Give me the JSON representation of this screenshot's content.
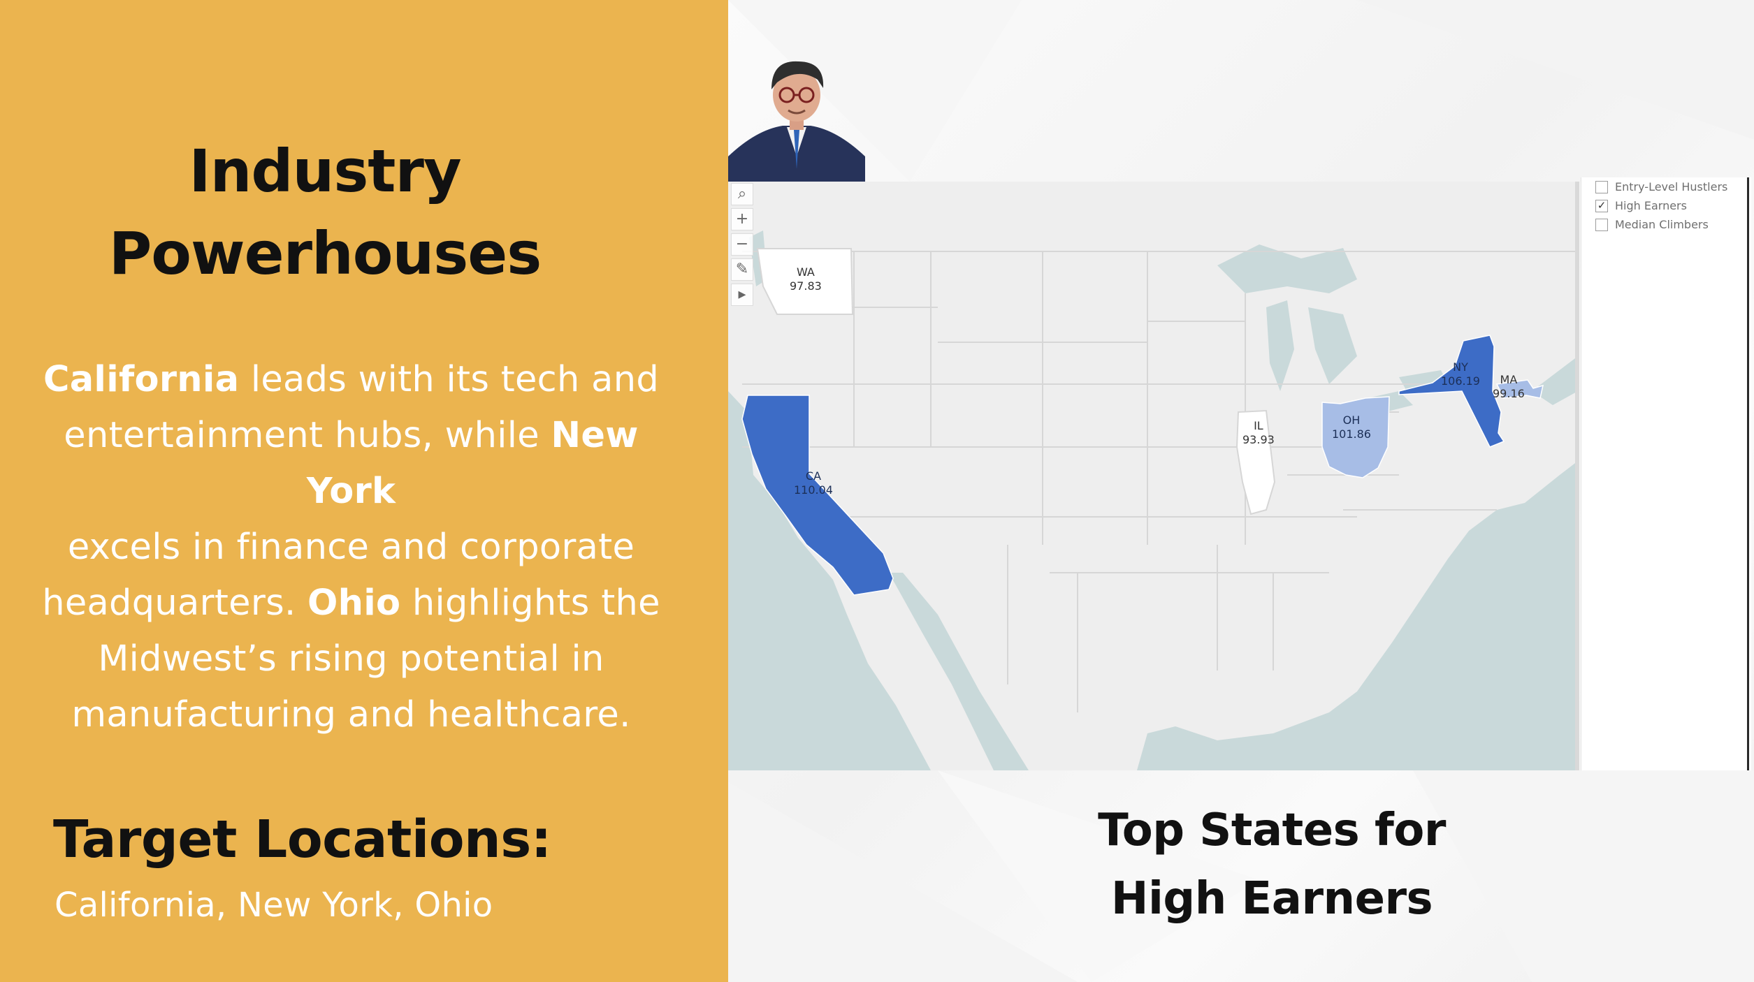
{
  "left": {
    "title_line1": "Industry",
    "title_line2": "Powerhouses",
    "body": [
      {
        "bold": "California",
        "text": " leads with its tech and"
      },
      {
        "bold": "",
        "text": "entertainment hubs, while "
      },
      {
        "bold": "New York",
        "text": ""
      },
      {
        "bold": "",
        "text": "excels in finance and corporate"
      },
      {
        "bold": "",
        "text": "headquarters. "
      },
      {
        "bold": "Ohio",
        "text": " highlights the"
      },
      {
        "bold": "",
        "text": "Midwest’s rising potential in"
      },
      {
        "bold": "",
        "text": "manufacturing and healthcare."
      }
    ],
    "target_heading": "Target Locations:",
    "target_list": "California, New York, Ohio"
  },
  "map": {
    "legend": [
      {
        "label": "Entry-Level Hustlers",
        "checked": false
      },
      {
        "label": "High Earners",
        "checked": true
      },
      {
        "label": "Median Climbers",
        "checked": false
      }
    ],
    "tools": [
      "search-icon",
      "zoom-in-icon",
      "zoom-out-icon",
      "pin-icon",
      "expand-icon"
    ],
    "states": [
      {
        "code": "WA",
        "value": "97.83",
        "shade": "none"
      },
      {
        "code": "CA",
        "value": "110.04",
        "shade": "dark"
      },
      {
        "code": "IL",
        "value": "93.93",
        "shade": "none"
      },
      {
        "code": "OH",
        "value": "101.86",
        "shade": "light"
      },
      {
        "code": "NY",
        "value": "106.19",
        "shade": "dark"
      },
      {
        "code": "MA",
        "value": "99.16",
        "shade": "light"
      }
    ],
    "colors": {
      "dark": "#3d6cc6",
      "light": "#a7bde6",
      "land": "#eeeeee",
      "water": "#c9d9da",
      "border": "#d6d6d6"
    }
  },
  "caption": {
    "line1": "Top States for",
    "line2": "High Earners"
  }
}
